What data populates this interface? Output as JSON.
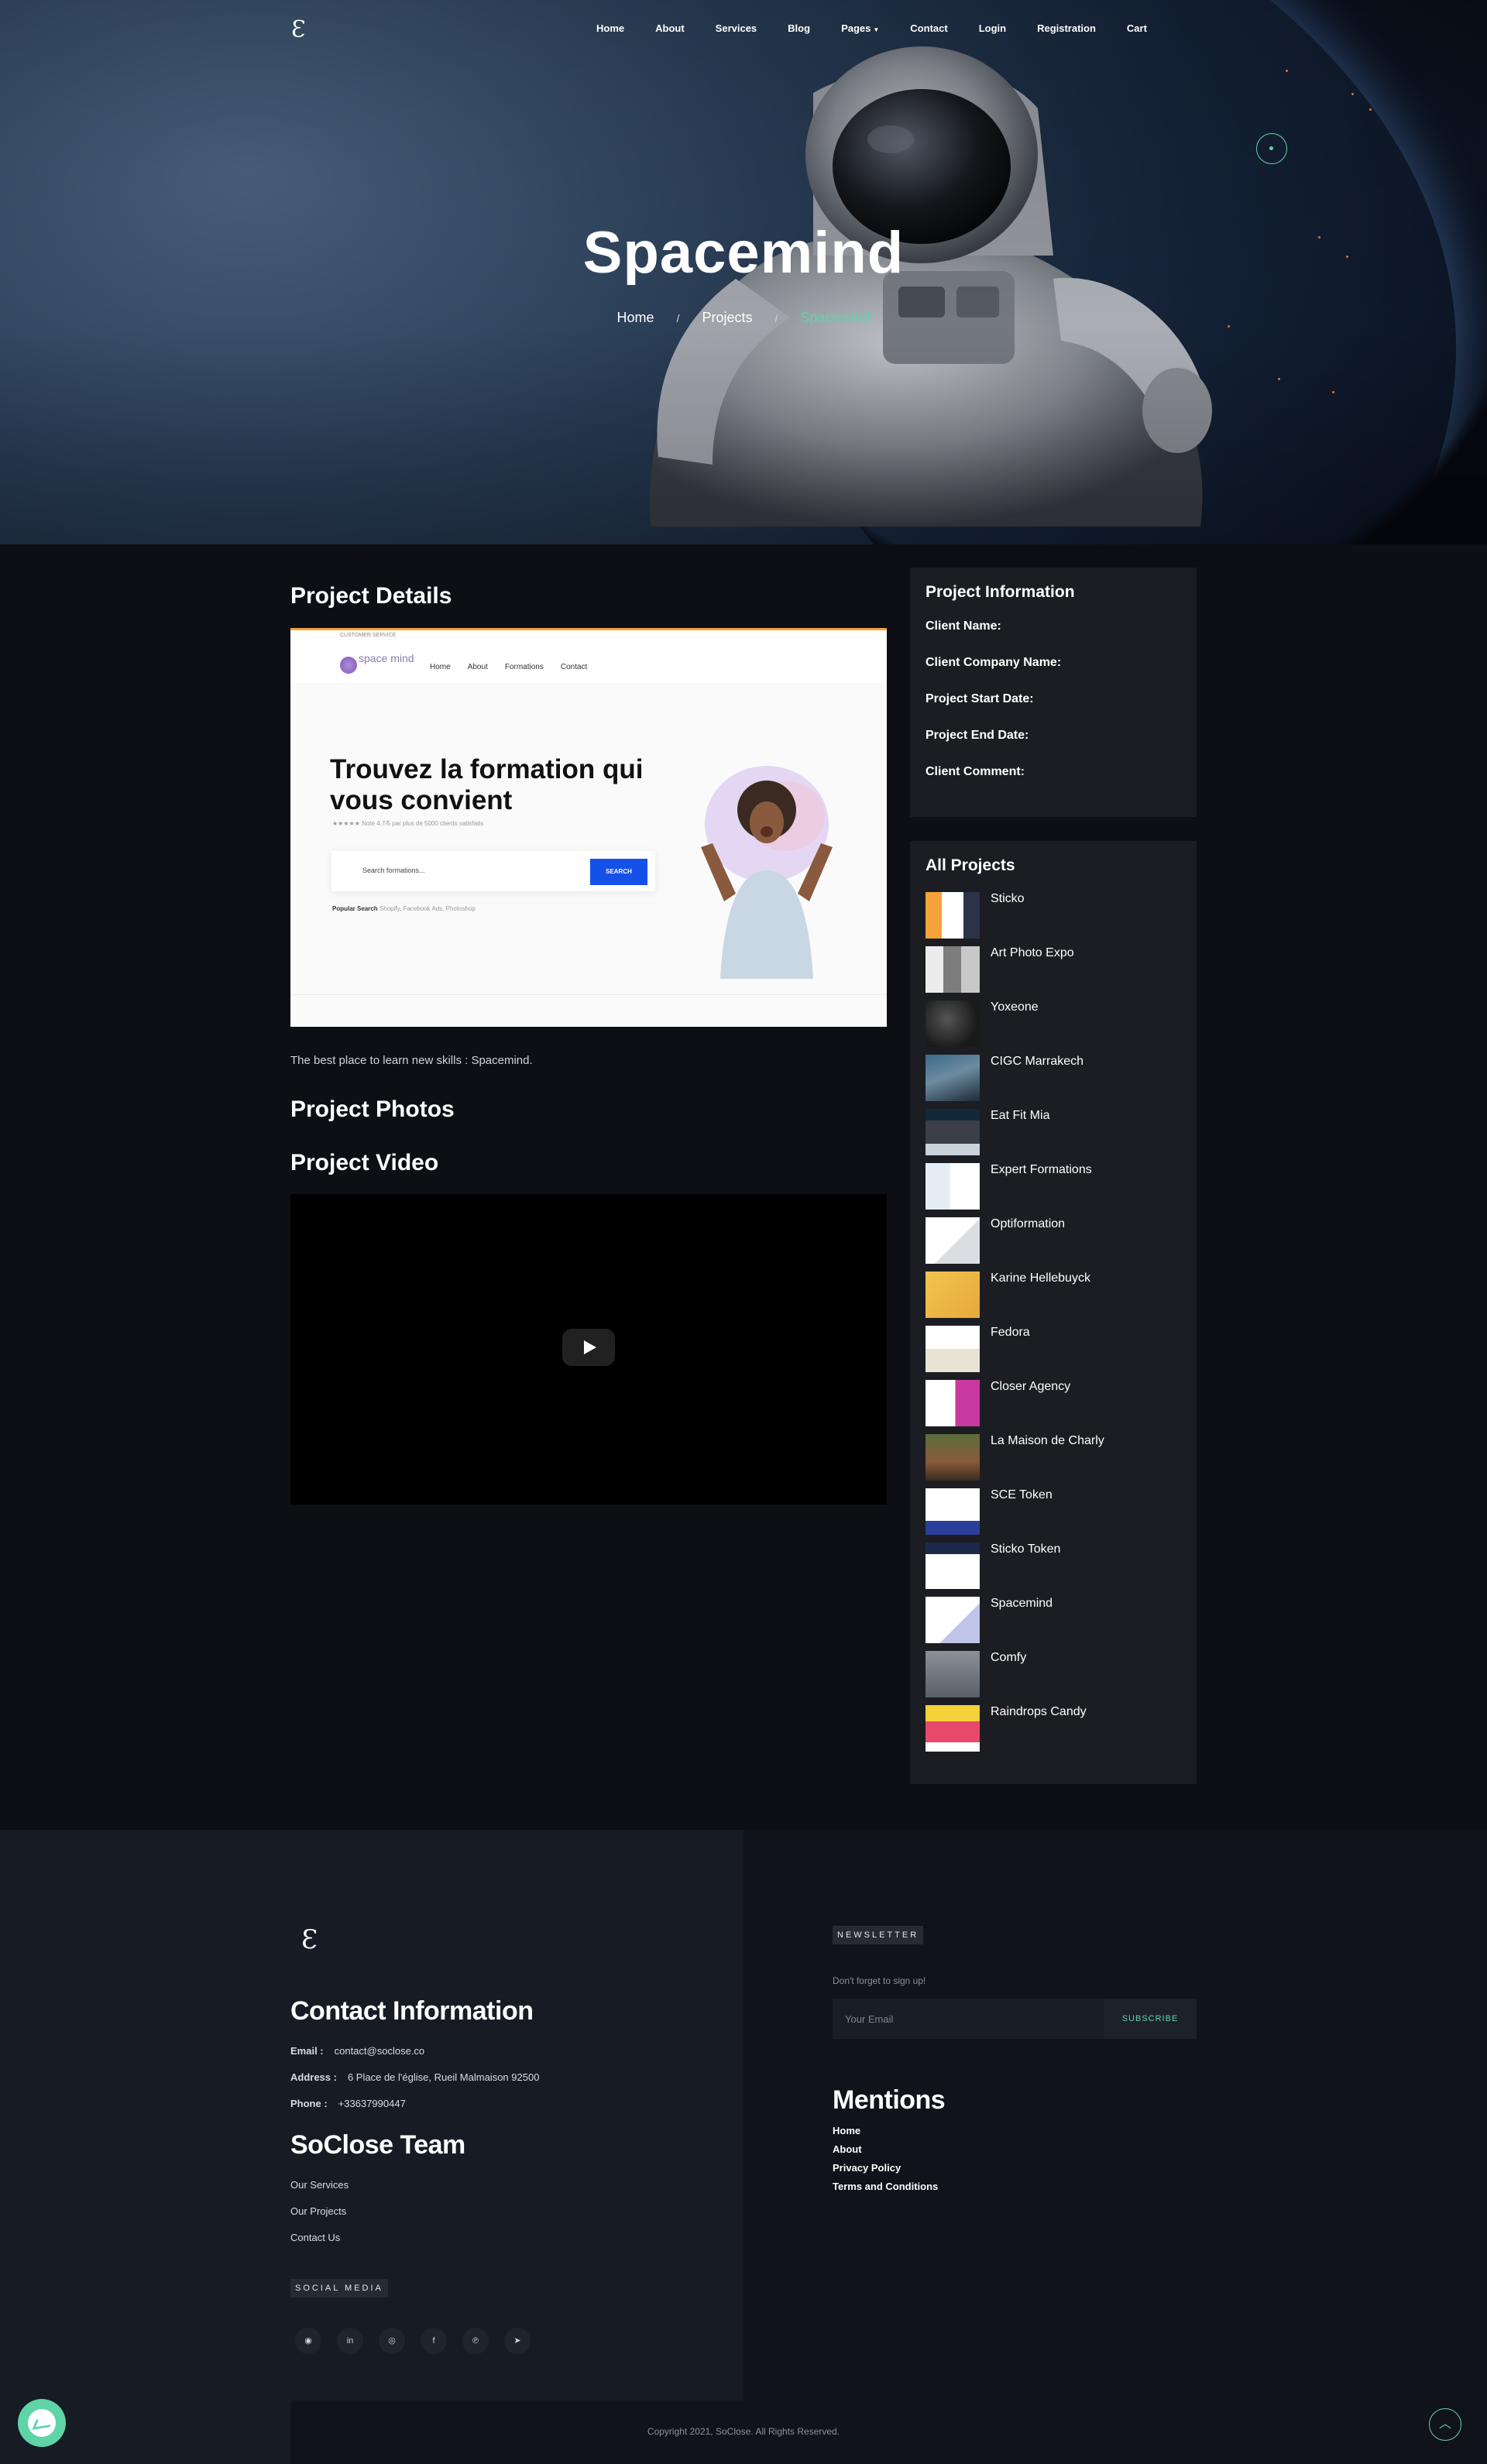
{
  "nav": {
    "logo": "Ɛ",
    "items": [
      {
        "label": "Home"
      },
      {
        "label": "About"
      },
      {
        "label": "Services"
      },
      {
        "label": "Blog"
      },
      {
        "label": "Pages"
      },
      {
        "label": "Contact"
      },
      {
        "label": "Login"
      },
      {
        "label": "Registration"
      },
      {
        "label": "Cart"
      }
    ]
  },
  "hero": {
    "title": "Spacemind",
    "breadcrumb": [
      "Home",
      "Projects",
      "Spacemind"
    ],
    "separator": "/"
  },
  "details": {
    "heading": "Project Details",
    "description": "The best place to learn new skills : Spacemind.",
    "photos_heading": "Project Photos",
    "video_heading": "Project Video",
    "screenshot": {
      "topbar": "CUSTOMER SERVICE",
      "brand": "space mind",
      "nav": [
        "Home",
        "About",
        "Formations",
        "Contact"
      ],
      "headline": "Trouvez la formation qui vous convient",
      "rating": "★★★★★ Noté 4.7/5 par plus de 5000 clients satisfaits",
      "search_placeholder": "Search formations...",
      "search_button": "SEARCH",
      "popular": "Popular Search",
      "popular_items": "Shopify, Facebook Ads, Photoshop"
    }
  },
  "info": {
    "heading": "Project Information",
    "rows": [
      "Client Name:",
      "Client Company Name:",
      "Project Start Date:",
      "Project End Date:",
      "Client Comment:"
    ]
  },
  "all_projects": {
    "heading": "All Projects",
    "items": [
      {
        "name": "Sticko",
        "thumb": "thumb-sticko"
      },
      {
        "name": "Art Photo Expo",
        "thumb": "thumb-artphoto"
      },
      {
        "name": "Yoxeone",
        "thumb": "thumb-yoxeone"
      },
      {
        "name": "CIGC Marrakech",
        "thumb": "thumb-cigc"
      },
      {
        "name": "Eat Fit Mia",
        "thumb": "thumb-eatfit"
      },
      {
        "name": "Expert Formations",
        "thumb": "thumb-expert"
      },
      {
        "name": "Optiformation",
        "thumb": "thumb-opti"
      },
      {
        "name": "Karine Hellebuyck",
        "thumb": "thumb-karine"
      },
      {
        "name": "Fedora",
        "thumb": "thumb-fedora"
      },
      {
        "name": "Closer Agency",
        "thumb": "thumb-closer"
      },
      {
        "name": "La Maison de Charly",
        "thumb": "thumb-maison"
      },
      {
        "name": "SCE Token",
        "thumb": "thumb-sce"
      },
      {
        "name": "Sticko Token",
        "thumb": "thumb-stickotoken"
      },
      {
        "name": "Spacemind",
        "thumb": "thumb-spacemind"
      },
      {
        "name": "Comfy",
        "thumb": "thumb-comfy"
      },
      {
        "name": "Raindrops Candy",
        "thumb": "thumb-raindrops"
      }
    ]
  },
  "footer": {
    "logo": "Ɛ",
    "contact_heading": "Contact Information",
    "email_label": "Email :",
    "email": "contact@soclose.co",
    "address_label": "Address :",
    "address": "6 Place de l'église, Rueil Malmaison 92500",
    "phone_label": "Phone :",
    "phone": "+33637990447",
    "team_heading": "SoClose Team",
    "team_links": [
      "Our Services",
      "Our Projects",
      "Contact Us"
    ],
    "social_tag": "SOCIAL MEDIA",
    "social_icons": [
      "github-icon",
      "linkedin-icon",
      "instagram-icon",
      "facebook-icon",
      "pinterest-icon",
      "telegram-icon"
    ],
    "newsletter_tag": "NEWSLETTER",
    "newsletter_hint": "Don't forget to sign up!",
    "email_placeholder": "Your Email",
    "subscribe": "SUBSCRIBE",
    "mentions_heading": "Mentions",
    "mentions_links": [
      "Home",
      "About",
      "Privacy Policy",
      "Terms and Conditions"
    ],
    "copyright": "Copyright 2021, SoClose. All Rights Reserved."
  },
  "colors": {
    "accent": "#5ed4a7",
    "bg": "#0d0f14",
    "card": "#1b1d22",
    "footer": "#171b23"
  }
}
